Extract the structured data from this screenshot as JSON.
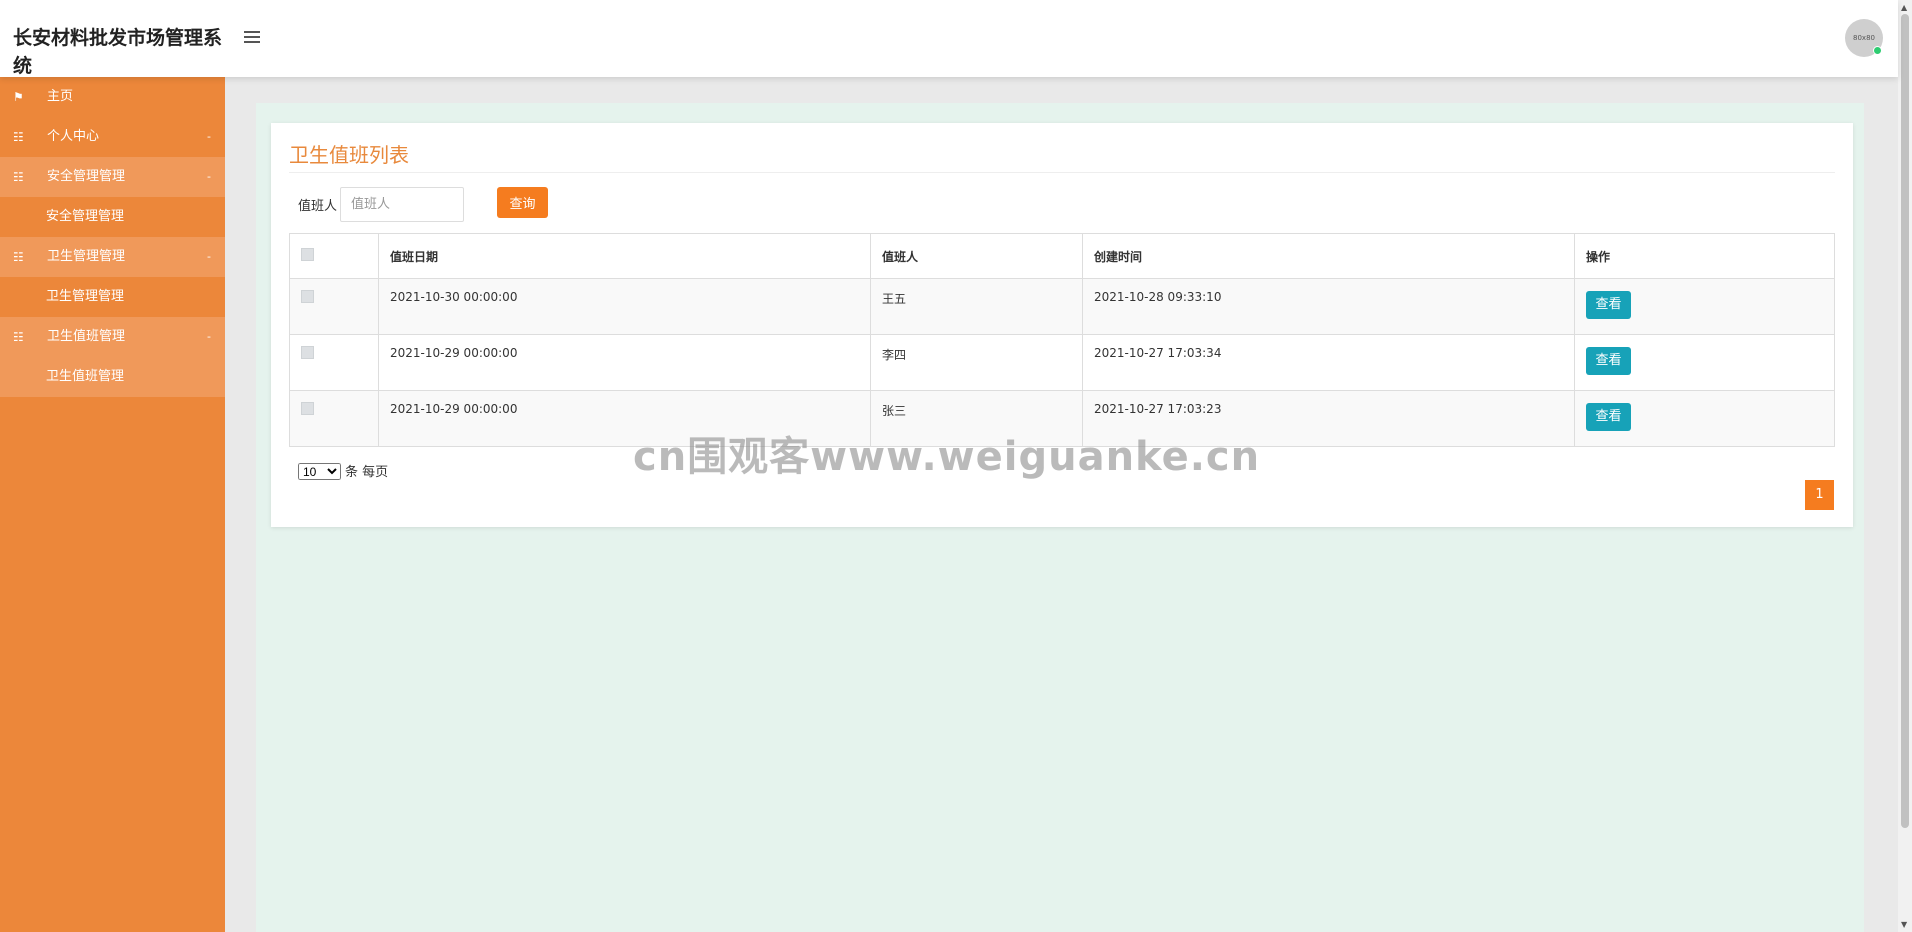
{
  "header": {
    "title": "长安材料批发市场管理系统",
    "avatar_text": "80x80"
  },
  "sidebar": {
    "items": [
      {
        "label": "主页",
        "icon": "flag-icon",
        "glyph": "⚑"
      },
      {
        "label": "个人中心",
        "icon": "list-icon",
        "glyph": "☷",
        "arrow": "-"
      },
      {
        "label": "安全管理管理",
        "icon": "list-icon",
        "glyph": "☷",
        "arrow": "-",
        "sub": "安全管理管理"
      },
      {
        "label": "卫生管理管理",
        "icon": "list-icon",
        "glyph": "☷",
        "arrow": "-",
        "sub": "卫生管理管理"
      },
      {
        "label": "卫生值班管理",
        "icon": "list-icon",
        "glyph": "☷",
        "arrow": "-",
        "sub": "卫生值班管理"
      }
    ]
  },
  "main": {
    "title": "卫生值班列表",
    "search": {
      "label": "值班人",
      "placeholder": "值班人",
      "button": "查询"
    },
    "table": {
      "headers": [
        "值班日期",
        "值班人",
        "创建时间",
        "操作"
      ],
      "rows": [
        {
          "date": "2021-10-30 00:00:00",
          "person": "王五",
          "created": "2021-10-28 09:33:10",
          "action": "查看"
        },
        {
          "date": "2021-10-29 00:00:00",
          "person": "李四",
          "created": "2021-10-27 17:03:34",
          "action": "查看"
        },
        {
          "date": "2021-10-29 00:00:00",
          "person": "张三",
          "created": "2021-10-27 17:03:23",
          "action": "查看"
        }
      ]
    },
    "pager": {
      "page_size": "10",
      "page_size_suffix": "条 每页",
      "current_page": "1"
    }
  },
  "watermark": "cn围观客www.weiguanke.cn",
  "colors": {
    "sidebar": "#ec873a",
    "accent": "#f57c1f",
    "view_button": "#17a2b8",
    "title": "#e8893c"
  }
}
